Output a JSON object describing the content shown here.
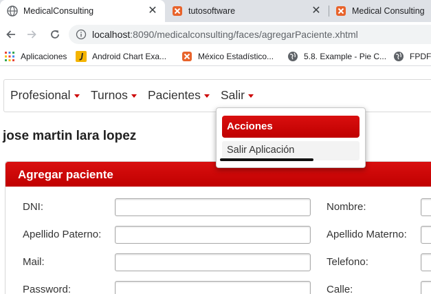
{
  "browser": {
    "tabs": [
      {
        "title": "MedicalConsulting",
        "active": true
      },
      {
        "title": "tutosoftware",
        "active": false
      },
      {
        "title": "Medical Consulting",
        "active": false
      }
    ],
    "close_glyph": "✕",
    "url_host": "localhost",
    "url_path": ":8090/medicalconsulting/faces/agregarPaciente.xhtml",
    "bookmarks": [
      "Aplicaciones",
      "Android Chart Exa...",
      "México Estadístico...",
      "5.8. Example - Pie C...",
      "FPDF"
    ],
    "colors": {
      "tabstrip": "#dee1e6",
      "omnibox": "#f1f3f4",
      "favicon_orange": "#e8632b"
    }
  },
  "page": {
    "menu": [
      "Profesional",
      "Turnos",
      "Pacientes",
      "Salir"
    ],
    "user_name": "jose martin lara lopez",
    "panel_title": "Agregar paciente",
    "form": {
      "left_labels": [
        "DNI:",
        "Apellido Paterno:",
        "Mail:",
        "Password:"
      ],
      "right_labels": [
        "Nombre:",
        "Apellido Materno:",
        "Telefono:",
        "Calle:"
      ]
    },
    "dropdown": {
      "header": "Acciones",
      "item": "Salir Aplicación"
    },
    "colors": {
      "accent_red": "#cc0000",
      "text": "#333333"
    }
  }
}
